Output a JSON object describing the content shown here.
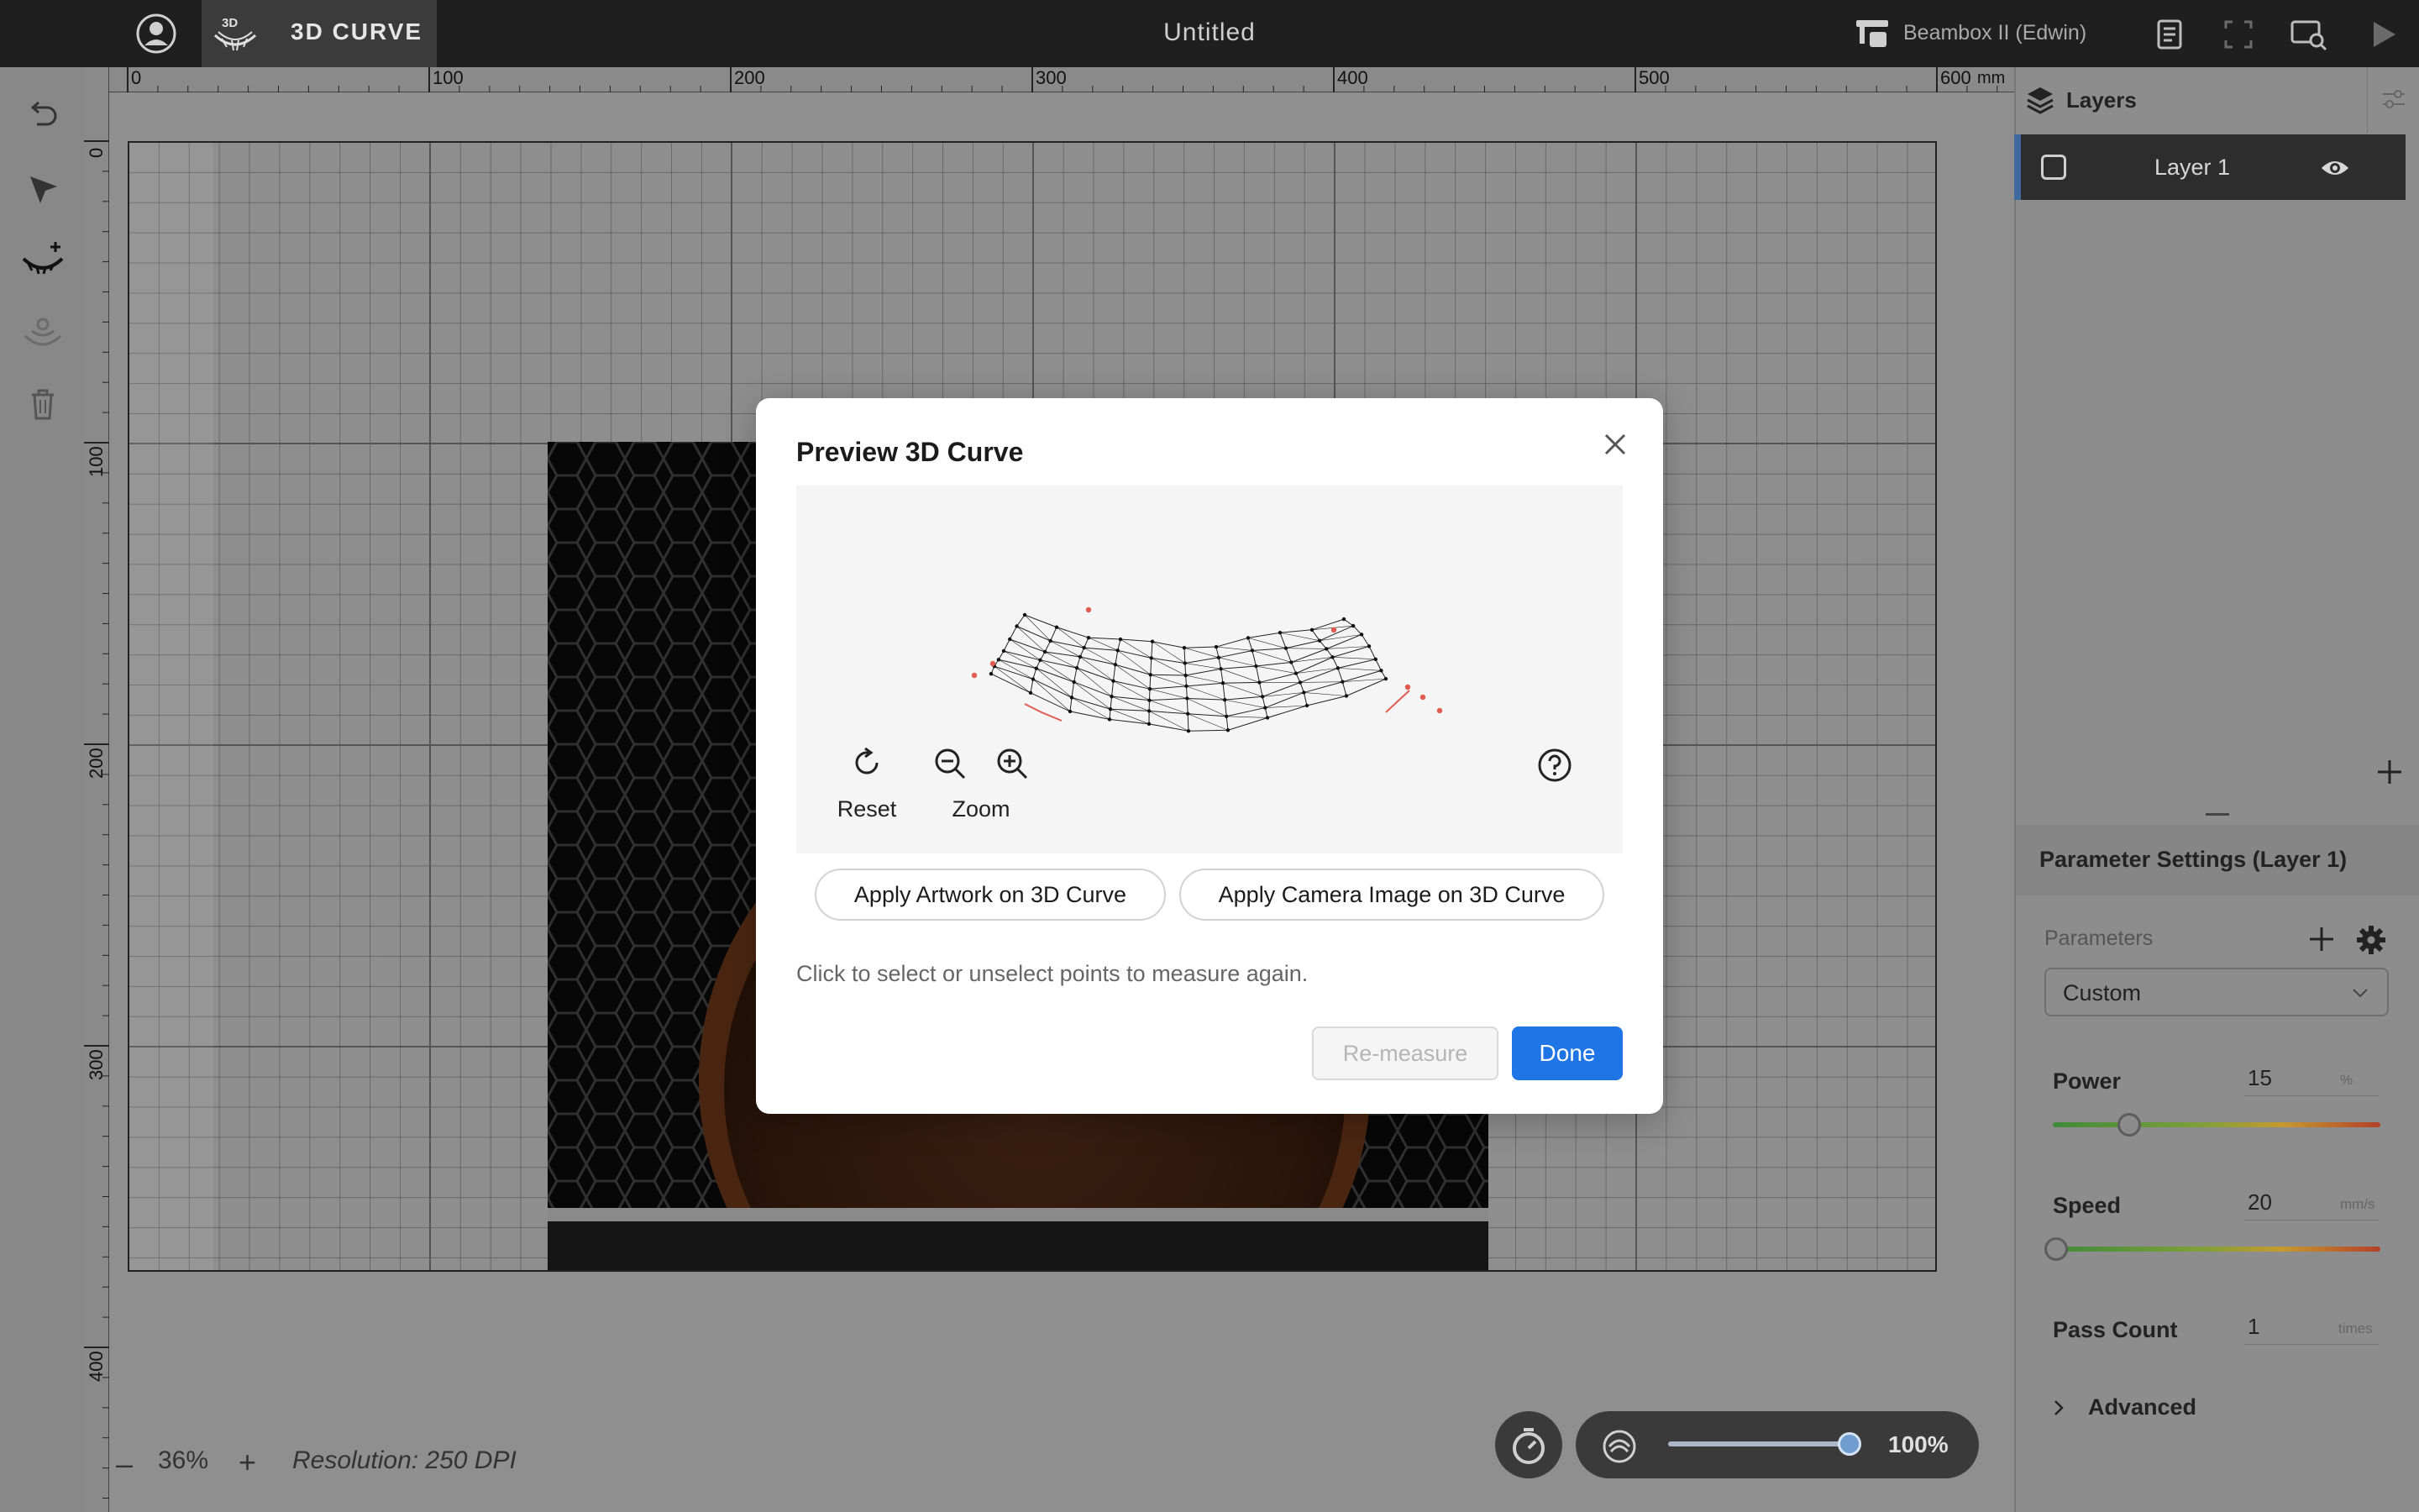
{
  "topbar": {
    "mode_label": "3D CURVE",
    "mode_icon_text": "3D",
    "document_title": "Untitled",
    "machine_name": "Beambox II (Edwin)"
  },
  "rulers": {
    "unit": "mm",
    "horizontal_ticks": [
      "0",
      "100",
      "200",
      "300",
      "400",
      "500",
      "600"
    ],
    "vertical_ticks": [
      "0",
      "100",
      "200",
      "300",
      "400"
    ]
  },
  "canvas": {
    "zoom_minus": "–",
    "zoom": "36%",
    "zoom_plus": "+",
    "resolution": "Resolution: 250 DPI",
    "preview_opacity": "100%",
    "preview_opacity_value": 1.0
  },
  "layers": {
    "title": "Layers",
    "items": [
      {
        "name": "Layer 1"
      }
    ]
  },
  "parameters": {
    "title": "Parameter Settings (Layer 1)",
    "section_label": "Parameters",
    "preset": "Custom",
    "power": {
      "label": "Power",
      "value": "15",
      "unit": "%",
      "fraction": 0.15
    },
    "speed": {
      "label": "Speed",
      "value": "20",
      "unit": "mm/s",
      "fraction": 0.0
    },
    "pass_count": {
      "label": "Pass Count",
      "value": "1",
      "unit": "times"
    },
    "advanced_label": "Advanced"
  },
  "modal": {
    "title": "Preview 3D Curve",
    "reset_label": "Reset",
    "zoom_label": "Zoom",
    "apply_artwork_label": "Apply Artwork on 3D Curve",
    "apply_camera_label": "Apply Camera Image on 3D Curve",
    "hint": "Click to select or unselect points to measure again.",
    "remeasure_label": "Re-measure",
    "done_label": "Done"
  },
  "colors": {
    "accent": "#1f75e6",
    "topbar": "#1f1f1f",
    "layer_highlight": "#3f6aa0",
    "measure_point_unselected": "#e05a50"
  },
  "icons": {
    "topbar": [
      "user-icon",
      "3d-curve-icon",
      "machine-icon",
      "document-icon",
      "frame-icon",
      "camera-search-icon",
      "play-icon"
    ],
    "left_toolbar": [
      "undo-icon",
      "cursor-icon",
      "curve-measure-icon",
      "curve-apply-icon",
      "trash-icon"
    ],
    "modal": [
      "close-icon",
      "reset-icon",
      "zoom-out-icon",
      "zoom-in-icon",
      "help-icon"
    ]
  }
}
